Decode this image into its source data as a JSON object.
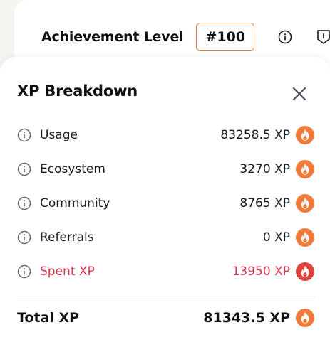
{
  "header": {
    "achievement_label": "Achievement Level",
    "achievement_value": "#100"
  },
  "modal": {
    "title": "XP Breakdown",
    "rows": [
      {
        "label": "Usage",
        "value": "83258.5 XP"
      },
      {
        "label": "Ecosystem",
        "value": "3270 XP"
      },
      {
        "label": "Community",
        "value": "8765 XP"
      },
      {
        "label": "Referrals",
        "value": "0 XP"
      },
      {
        "label": "Spent XP",
        "value": "13950 XP"
      }
    ],
    "total": {
      "label": "Total XP",
      "value": "81343.5 XP"
    }
  },
  "colors": {
    "flame_orange": "#f07a3a",
    "flame_red": "#e0443f",
    "spent_text": "#d9334a",
    "badge_border": "#e07a3e"
  },
  "icons": {
    "info": "info-circle-icon",
    "close": "close-icon",
    "xp": "flame-icon"
  }
}
